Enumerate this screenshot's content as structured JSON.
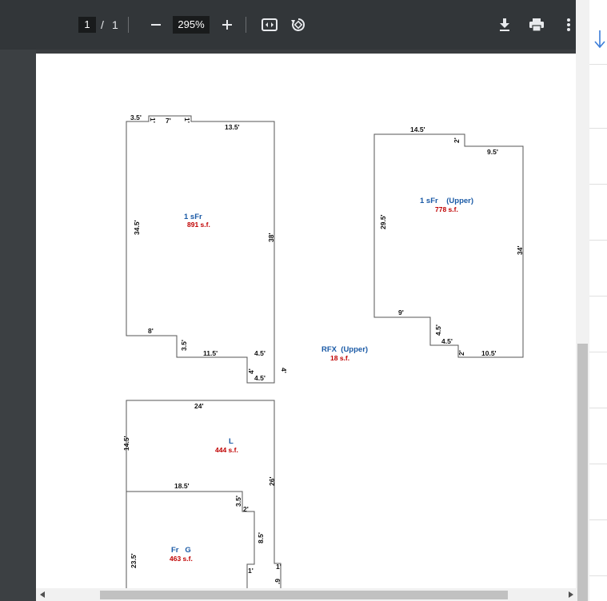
{
  "toolbar": {
    "page_current": "1",
    "page_separator": "/",
    "page_total": "1",
    "zoom_value": "295%"
  },
  "colors": {
    "toolbar_bg": "#323639",
    "label_blue": "#1a5aa6",
    "area_red": "#c00000",
    "outline": "#555555"
  },
  "drawing": {
    "dims": {
      "d35a": "3.5'",
      "d1a": "1'",
      "d7": "7'",
      "d1b": "1'",
      "d135": "13.5'",
      "d345": "34.5'",
      "d38": "38'",
      "d8": "8'",
      "d35b": "3.5'",
      "d115": "11.5'",
      "d45a": "4.5'",
      "d4a": "4'",
      "d4b": "4'",
      "d45b": "4.5'",
      "u145": "14.5'",
      "u2a": "2'",
      "u95": "9.5'",
      "u295": "29.5'",
      "u34": "34'",
      "u9": "9'",
      "u45a": "4.5'",
      "u45b": "4.5'",
      "u2b": "2'",
      "u105": "10.5'",
      "l24": "24'",
      "l145": "14.5'",
      "l26": "26'",
      "g185": "18.5'",
      "g35": "3.5'",
      "g2": "2'",
      "g85": "8.5'",
      "g235": "23.5'",
      "g1a": "1'",
      "g1b": "1'",
      "g6": "6'"
    },
    "areas": {
      "sfr1_label": "1 sFr",
      "sfr1_area": "891 s.f.",
      "upper_label": "1 sFr    (Upper)",
      "upper_area": "778 s.f.",
      "rfx_label": "RFX  (Upper)",
      "rfx_area": "18 s.f.",
      "l_label": "L",
      "l_area": "444 s.f.",
      "frg_label": "Fr   G",
      "frg_area": "463 s.f."
    }
  },
  "icons": {
    "zoom_out": "minus-icon",
    "zoom_in": "plus-icon",
    "fit": "fit-to-page-icon",
    "rotate": "rotate-icon",
    "download": "download-icon",
    "print": "print-icon",
    "more": "more-vert-icon",
    "side_arrow": "arrow-down-icon"
  }
}
